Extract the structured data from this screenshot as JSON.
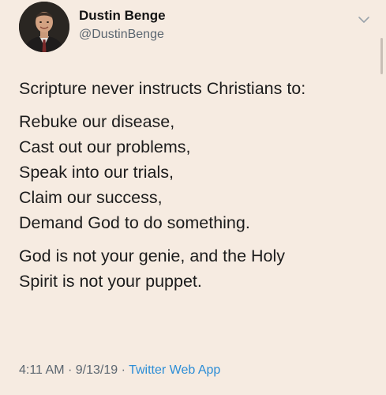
{
  "author": {
    "name": "Dustin Benge",
    "handle": "@DustinBenge"
  },
  "tweet": {
    "intro": "Scripture never instructs Christians to:",
    "list": [
      "Rebuke our disease,",
      "Cast out our problems,",
      "Speak into our trials,",
      "Claim our success,",
      "Demand God to do something."
    ],
    "closing_line1": "God is not your genie, and the Holy",
    "closing_line2": "Spirit is not your puppet."
  },
  "meta": {
    "time": "4:11 AM",
    "separator": "·",
    "date": "9/13/19",
    "source": "Twitter Web App"
  },
  "colors": {
    "background": "#f6ebe1",
    "text": "#1c1c1c",
    "muted": "#5b6670",
    "link": "#2b8dd6"
  },
  "icons": {
    "menu": "chevron-down-icon"
  }
}
